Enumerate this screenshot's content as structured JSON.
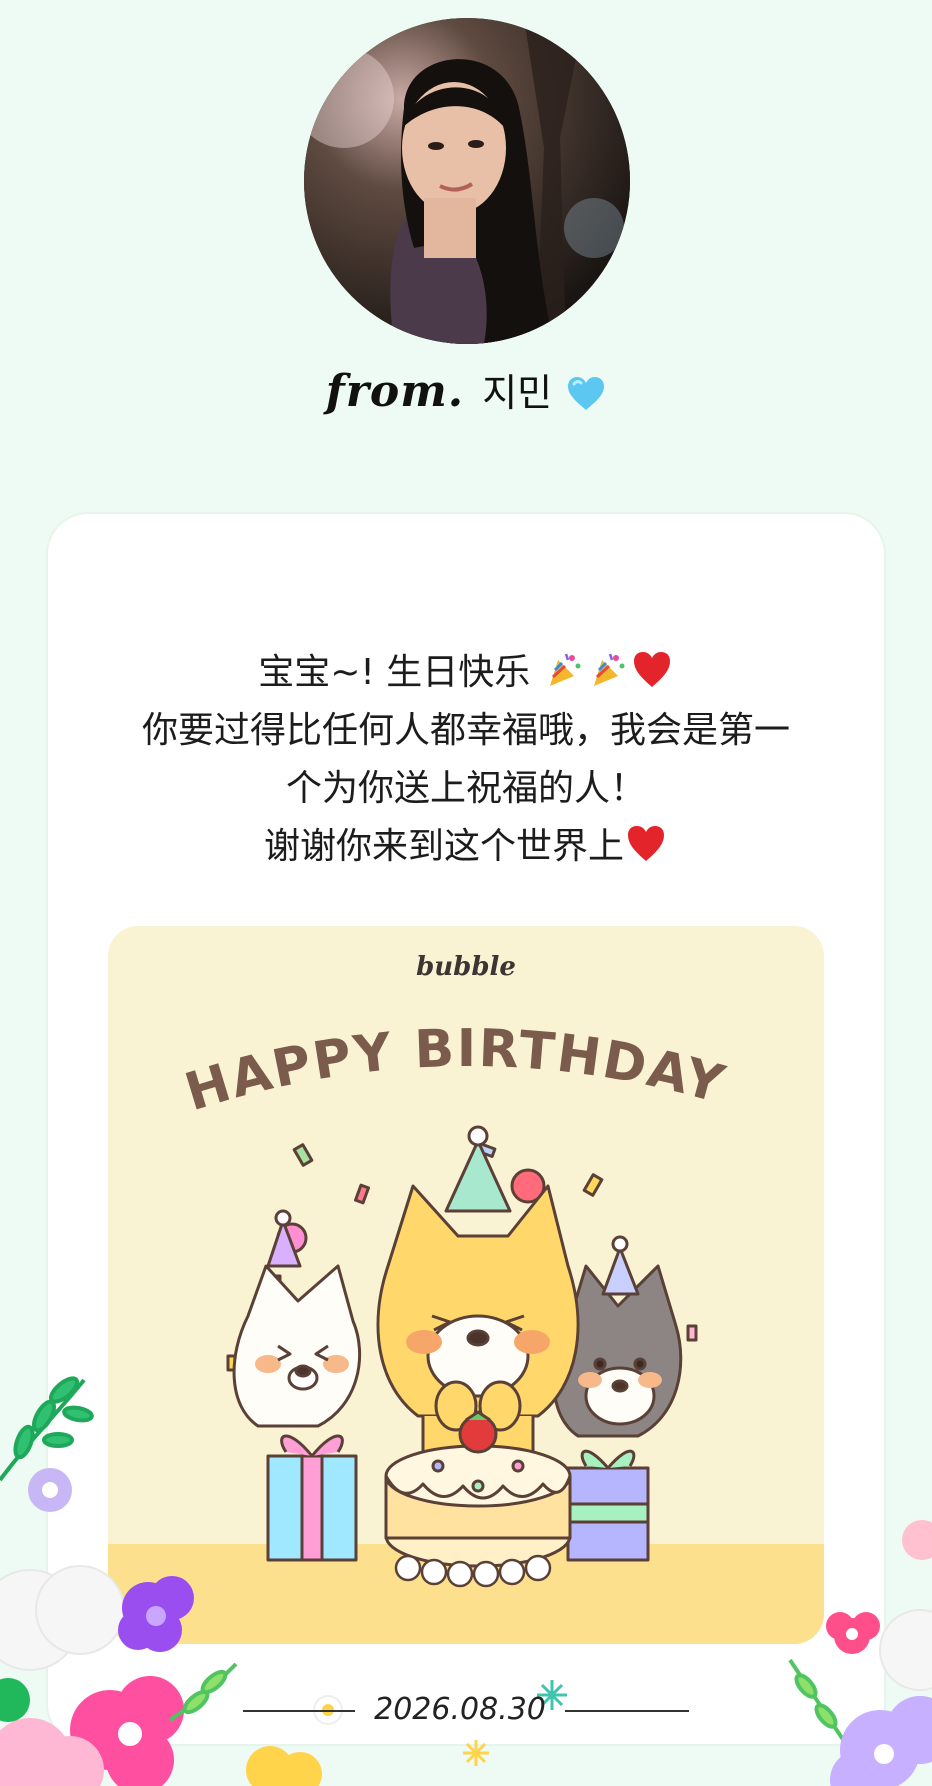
{
  "sender": {
    "from_label": "from.",
    "name": "지민",
    "heart_icon": "blue-heart-icon",
    "avatar_icon": "profile-photo"
  },
  "message": {
    "line1_text": "宝宝~! 生日快乐",
    "line1_emojis": [
      "party-popper-icon",
      "party-popper-icon",
      "red-heart-icon"
    ],
    "line2": "你要过得比任何人都幸福哦，我会是第一",
    "line3": "个为你送上祝福的人！",
    "line4_text": "谢谢你来到这个世界上",
    "line4_emoji": "red-heart-icon"
  },
  "birthday_card": {
    "brand": "bubble",
    "headline": "HAPPY BIRTHDAY!",
    "illustration": "three-shiba-dogs-with-cake-and-gifts"
  },
  "footer": {
    "date": "2026.08.30"
  },
  "colors": {
    "page_bg": "#eefaf4",
    "card_bg": "#ffffff",
    "bday_bg": "#f9f3d4",
    "bday_floor": "#fde08d",
    "headline": "#7a5b4c"
  }
}
